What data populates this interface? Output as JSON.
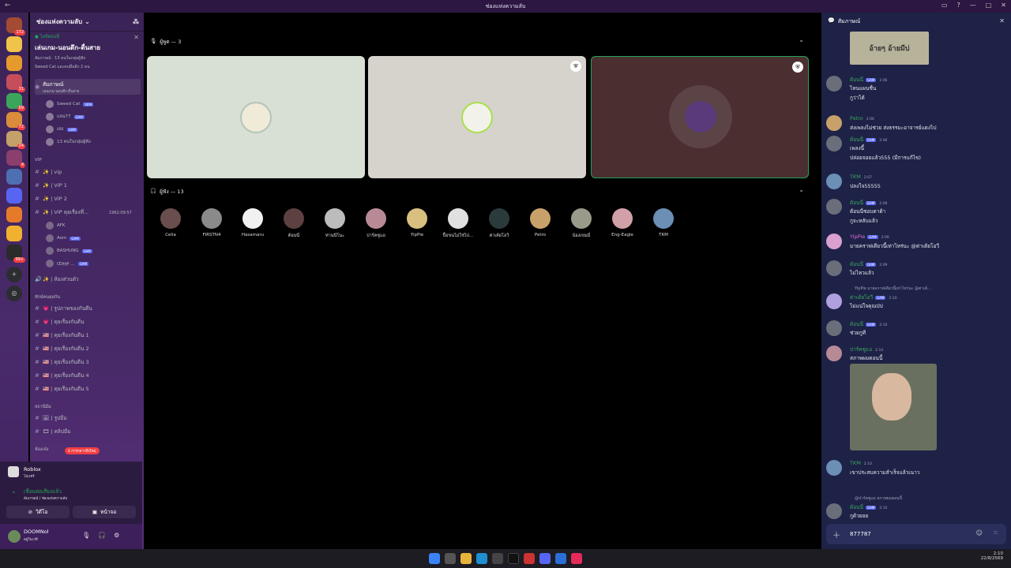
{
  "window": {
    "title": "ช่องแห่งความลับ"
  },
  "servers": [
    {
      "badge": "172",
      "color": "#a34b33"
    },
    {
      "badge": "",
      "color": "#f0c34a"
    },
    {
      "badge": "",
      "color": "#e59a2d"
    },
    {
      "badge": "31",
      "color": "#c44e5b"
    },
    {
      "badge": "69",
      "color": "#3ba55c"
    },
    {
      "badge": "72",
      "color": "#d98c3c"
    },
    {
      "badge": "24",
      "color": "#c4a06a"
    },
    {
      "badge": "4",
      "color": "#8a3f6d"
    },
    {
      "badge": "",
      "color": "#4f6fb3"
    },
    {
      "badge": "",
      "color": "#5865f2"
    },
    {
      "badge": "",
      "color": "#e57b2a"
    },
    {
      "badge": "",
      "color": "#f0b030"
    },
    {
      "badge": "99+",
      "color": "#2b2b2b"
    }
  ],
  "guild": {
    "name": "ช่องแห่งความลับ"
  },
  "event": {
    "live": "● ไลฟ์ตอนนี้",
    "name": "เล่นเกม-นอนดึก-ตื่นสาย",
    "sub1": "สัมภาษณ์ · 13 คนในกลุ่มผู้ฟัง",
    "sub2": "Sweed Cat และคนอื่นอีก 2 คน"
  },
  "stage": {
    "label": "สัมภาษณ์",
    "sub": "เล่นเกม-นอนดึก-ตื่นสาย"
  },
  "stage_members": [
    {
      "name": "Sweed Cat",
      "tag": "SIRA"
    },
    {
      "name": "แจน77",
      "tag": "GAM"
    },
    {
      "name": "เสธ",
      "tag": "GAM"
    },
    {
      "name": "13 คนในกลุ่มผู้ฟัง",
      "tag": ""
    }
  ],
  "vip": {
    "category": "VIP",
    "channels": [
      "✨ | vip",
      "✨ | VIP 1",
      "✨ | VIP 2",
      "✨ | VIP คุยเรื่องที่...",
      "✨ | ห้องส่วนตัว"
    ],
    "timer": "1962:09:57",
    "members": [
      {
        "name": "AFK",
        "tag": ""
      },
      {
        "name": "Aom",
        "tag": "GAM"
      },
      {
        "name": "BASHUNG",
        "tag": "GAM"
      },
      {
        "name": "ꝎꞎꞎꞘ ...",
        "tag": "GAM"
      }
    ]
  },
  "cat2": {
    "category": "ทักษ์คนคุยกัน",
    "channels": [
      "💗 | รูปภาพของกันดีน",
      "💗 | คุยเรื่องกันดีน",
      "🇺🇸 | คุยเรื่องกันดีน 1",
      "🇺🇸 | คุยเรื่องกันดีน 2",
      "🇺🇸 | คุยเรื่องกันดีน 3",
      "🇺🇸 | คุยเรื่องกันดีน 4",
      "🇺🇸 | คุยเรื่องกันดีน 5"
    ]
  },
  "cat3": {
    "category": "สถานีมีม",
    "channels": [
      "🖼 | รูปมีม",
      "🎞 | คลิปมีม"
    ]
  },
  "cat4": {
    "category": "ห้องเจ๋ง",
    "mention_pill": "4 การกล่าวถึงใหม่"
  },
  "activity": {
    "game": "Roblox",
    "sub": "ไม่แชร์"
  },
  "voice": {
    "status": "เชื่อมต่อเสียงแล้ว",
    "sub": "สัมภาษณ์ / ช่องแห่งความลับ",
    "video": "วิดีโอ",
    "screen": "หน้าจอ"
  },
  "user": {
    "name": "DOOMNol",
    "status": "อยู่ในเวที"
  },
  "speakers": {
    "label": "ผู้พูด — 3"
  },
  "listeners": {
    "label": "ผู้ฟัง — 13",
    "people": [
      {
        "name": "Celia",
        "color": "#6a4d4d"
      },
      {
        "name": "FIRSTN4",
        "color": "#8a8a8a"
      },
      {
        "name": "Hasamaru",
        "color": "#f1f1f1"
      },
      {
        "name": "ต้อนนี่",
        "color": "#5c4140"
      },
      {
        "name": "ท่านนีโนะ",
        "color": "#bcbcbc"
      },
      {
        "name": "ปาร์คซูแอ",
        "color": "#b88a96"
      },
      {
        "name": "YipPie",
        "color": "#d9c080"
      },
      {
        "name": "ปื้อขนไม่ใช่ไป...",
        "color": "#e0e0e0"
      },
      {
        "name": "ต่าเต้ยโอวี",
        "color": "#2b3b3b"
      },
      {
        "name": "Petro",
        "color": "#c8a16a"
      },
      {
        "name": "น้องเขมมี่",
        "color": "#9a9a8a"
      },
      {
        "name": "Eng-Eagle",
        "color": "#d2a0a8"
      },
      {
        "name": "TKM",
        "color": "#6b8fb5"
      }
    ]
  },
  "chat": {
    "title": "สัมภาษณ์",
    "sticker_text": "อ้ายๆ อ้ายมีบ่",
    "messages": [
      {
        "name": "ต้อนนี่",
        "tag": "GAM",
        "time": "2:06",
        "lines": [
          "ไหนแผนชื่น",
          "กูว่าได้"
        ],
        "color": "#3ba55c"
      },
      {
        "name": "Petro",
        "tag": "",
        "time": "2:06",
        "lines": [
          "ส่งเพลงไม่ช่วย ส่งธรรมะอาจารย์แดงไป"
        ],
        "color": "#3ba55c"
      },
      {
        "name": "ต้อนนี่",
        "tag": "GAM",
        "time": "2:06",
        "lines": [
          "เพลงนี้",
          "ปล่อยจอยแล้ว555 (มีการแก้ไข)"
        ],
        "color": "#3ba55c"
      },
      {
        "name": "TKM",
        "tag": "",
        "time": "2:07",
        "lines": [
          "ปลงใจ55555"
        ],
        "color": "#3ba55c"
      },
      {
        "name": "ต้อนนี่",
        "tag": "GAM",
        "time": "2:08",
        "lines": [
          "ต้อนนี่ชอบดาต้า",
          "กูจะหลับแล้ว"
        ],
        "color": "#3ba55c"
      },
      {
        "name": "YipPie",
        "tag": "GAM",
        "time": "2:09",
        "lines": [
          "มายคราฟเดียวนี้เท่าไหร่นะ @ต่าเต้ยโอวี"
        ],
        "color": "#e06adb"
      },
      {
        "name": "ต้อนนี่",
        "tag": "GAM",
        "time": "2:09",
        "lines": [
          "ไม่ไหวแล้ว"
        ],
        "color": "#3ba55c"
      },
      {
        "name": "ต่าเต้ยโอวี",
        "tag": "GAM",
        "time": "2:10",
        "lines": [
          "ไม่แน่ใจคุณป่ป"
        ],
        "color": "#3ba55c",
        "reply": "YipPie มายคราฟเดียวนี้เท่าไหร่นะ @ต่าเต้..."
      },
      {
        "name": "ต้อนนี่",
        "tag": "GAM",
        "time": "2:10",
        "lines": [
          "ช่วยกูที"
        ],
        "color": "#3ba55c"
      },
      {
        "name": "ปาร์คซูแอ",
        "tag": "",
        "time": "2:10",
        "lines": [
          "สภาพผมตอนนี้"
        ],
        "color": "#3ba55c"
      },
      {
        "name": "TKM",
        "tag": "",
        "time": "2:10",
        "lines": [
          "เขาประสบความสำเร็จแล้วเนาว"
        ],
        "color": "#3ba55c"
      },
      {
        "name": "ต้อนนี่",
        "tag": "GAM",
        "time": "2:10",
        "lines": [
          "กูด้วยยย"
        ],
        "color": "#3ba55c",
        "reply": "@ปาร์คซูแอ สภาพผมตอนนี้"
      }
    ],
    "input_value": "877787"
  },
  "clock": {
    "time": "2:10",
    "date": "22/8/2569"
  }
}
